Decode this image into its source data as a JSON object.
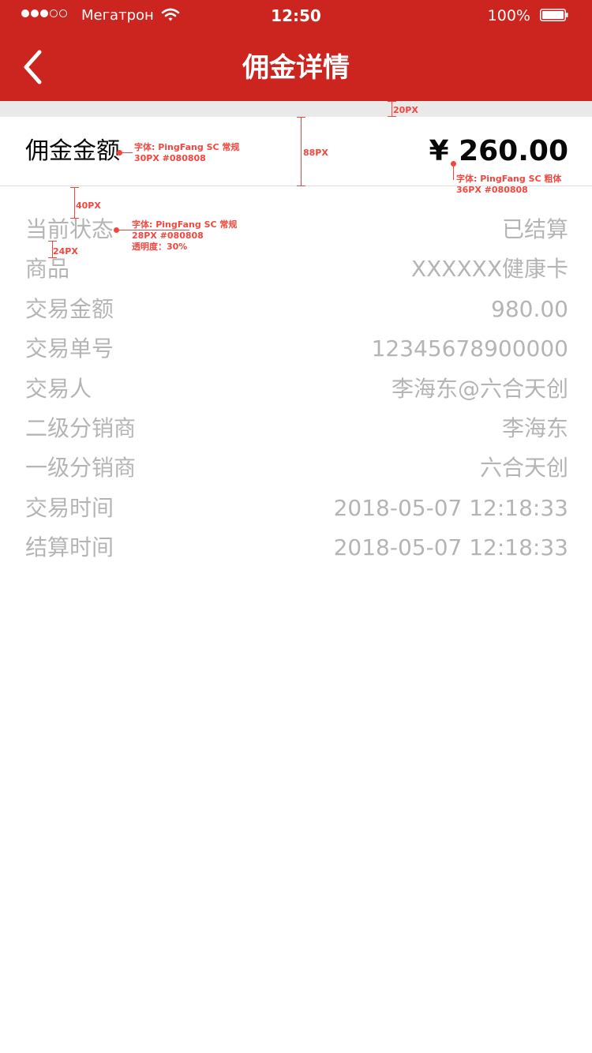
{
  "status_bar": {
    "carrier": "Мегатрон",
    "time": "12:50",
    "battery": "100%"
  },
  "nav": {
    "title": "佣金详情",
    "back_icon": "chevron-left-icon"
  },
  "commission": {
    "label": "佣金金额",
    "amount": "¥ 260.00"
  },
  "details": [
    {
      "label": "当前状态",
      "value": "已结算"
    },
    {
      "label": "商品",
      "value": "XXXXXX健康卡"
    },
    {
      "label": "交易金额",
      "value": "980.00"
    },
    {
      "label": "交易单号",
      "value": "12345678900000"
    },
    {
      "label": "交易人",
      "value": "李海东@六合天创"
    },
    {
      "label": "二级分销商",
      "value": "李海东"
    },
    {
      "label": "一级分销商",
      "value": "六合天创"
    },
    {
      "label": "交易时间",
      "value": "2018-05-07 12:18:33"
    },
    {
      "label": "结算时间",
      "value": "2018-05-07 12:18:33"
    }
  ],
  "annotations": {
    "spacer_height": "20PX",
    "label_font": "字体: PingFang SC 常规",
    "label_size": "30PX #080808",
    "row_height": "88PX",
    "amount_font": "字体: PingFang SC 粗体",
    "amount_size": "36PX #080808",
    "top_gap": "40PX",
    "detail_font": "字体: PingFang SC 常规",
    "detail_size": "28PX #080808",
    "detail_opacity": "透明度：30%",
    "row_gap": "24PX"
  },
  "colors": {
    "brand_red": "#cc2520",
    "text": "#080808",
    "annotation": "#f2473f"
  }
}
